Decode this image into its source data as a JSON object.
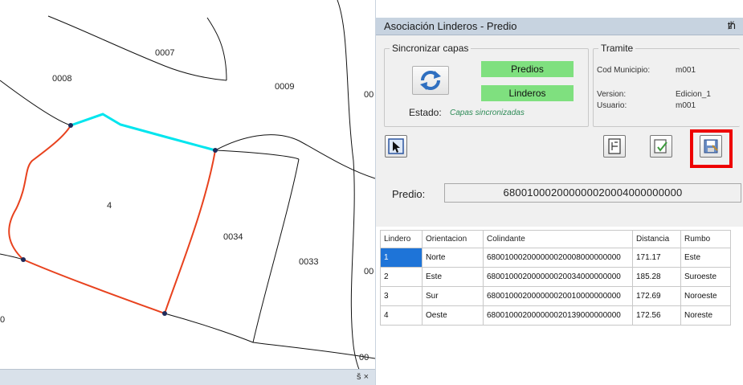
{
  "map": {
    "parcel_labels": [
      "0007",
      "0008",
      "0009",
      "00",
      "4",
      "0034",
      "0033",
      "00",
      "0",
      "00"
    ],
    "colors": {
      "selected_boundary": "#00e5ee",
      "predio_boundary": "#e8421e",
      "lines": "#111111"
    },
    "bottom_controls": "š ×"
  },
  "panel": {
    "title": "Asociación Linderos -  Predio",
    "pin_icon": "pin-icon",
    "sync": {
      "legend": "Sincronizar capas",
      "predios_label": "Predios",
      "linderos_label": "Linderos",
      "estado_label": "Estado:",
      "estado_value": "Capas sincronizadas",
      "badge_color": "#7fe07f"
    },
    "tramite": {
      "legend": "Tramite",
      "cod_label": "Cod Municipio:",
      "cod_value": "m001",
      "version_label": "Version:",
      "version_value": "Edicion_1",
      "usuario_label": "Usuario:",
      "usuario_value": "m001"
    },
    "tools": [
      "select-feature-icon",
      "layers-icon",
      "validate-icon",
      "save-icon"
    ],
    "predio": {
      "label": "Predio:",
      "value": "680010002000000020004000000000"
    },
    "grid": {
      "columns": [
        "Lindero",
        "Orientacion",
        "Colindante",
        "Distancia",
        "Rumbo"
      ],
      "rows": [
        [
          "1",
          "Norte",
          "680010002000000020008000000000",
          "171.17",
          "Este"
        ],
        [
          "2",
          "Este",
          "680010002000000020034000000000",
          "185.28",
          "Suroeste"
        ],
        [
          "3",
          "Sur",
          "680010002000000020010000000000",
          "172.69",
          "Noroeste"
        ],
        [
          "4",
          "Oeste",
          "680010002000000020139000000000",
          "172.56",
          "Noreste"
        ]
      ],
      "selected_row": 0,
      "selection_color": "#1e74d8"
    }
  }
}
